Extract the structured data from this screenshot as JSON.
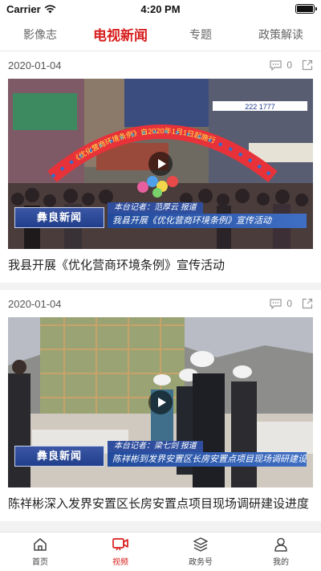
{
  "status": {
    "carrier": "Carrier",
    "time": "4:20 PM"
  },
  "tabs": [
    {
      "label": "影像志"
    },
    {
      "label": "电视新闻"
    },
    {
      "label": "专题"
    },
    {
      "label": "政策解读"
    }
  ],
  "feed": [
    {
      "date": "2020-01-04",
      "comments": "0",
      "title": "我县开展《优化营商环境条例》宣传活动",
      "overlay": {
        "logo": "彝良新闻",
        "reporter": "本台记者：范厚云  报道",
        "headline": "我县开展《优化营商环境条例》宣传活动",
        "arch_banner": "《优化营商环境条例》自2020年1月1日起施行",
        "sign": "222 1777"
      }
    },
    {
      "date": "2020-01-04",
      "comments": "0",
      "title": "陈祥彬深入发界安置区长房安置点项目现场调研建设进度",
      "overlay": {
        "logo": "彝良新闻",
        "reporter": "本台记者：梁七剑  报道",
        "headline": "陈祥彬到发界安置区长房安置点项目现场调研建设进度"
      }
    }
  ],
  "tabbar": [
    {
      "label": "首页",
      "icon": "home-icon"
    },
    {
      "label": "视频",
      "icon": "video-icon"
    },
    {
      "label": "政务号",
      "icon": "layers-icon"
    },
    {
      "label": "我的",
      "icon": "user-icon"
    }
  ],
  "colors": {
    "accent": "#d81e1e"
  }
}
